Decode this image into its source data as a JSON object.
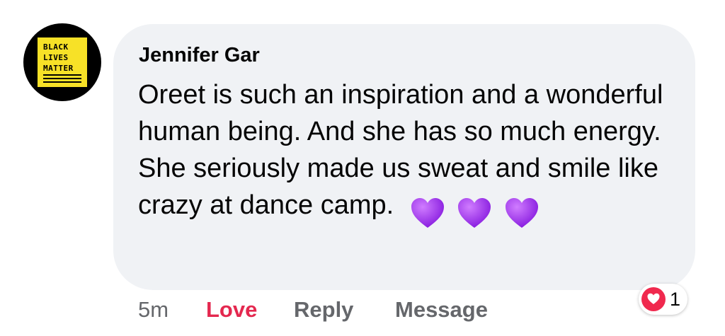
{
  "avatar": {
    "lines": [
      "BLACK",
      "LIVES",
      "MATTER"
    ],
    "colors": {
      "ring": "#000000",
      "tile": "#f7e127",
      "text": "#000000"
    }
  },
  "comment": {
    "author": "Jennifer Gar",
    "text": "Oreet is such an inspiration and a wonderful human being. And she has so much energy. She seriously made us sweat and smile like crazy at dance camp.",
    "emoji": [
      "purple-heart",
      "purple-heart",
      "purple-heart"
    ],
    "bubble_color": "#f0f2f5"
  },
  "actions": {
    "time": "5m",
    "love": "Love",
    "reply": "Reply",
    "message": "Message",
    "love_color": "#e4284f"
  },
  "reaction": {
    "icon": "heart-icon",
    "count": "1",
    "color": "#f0294e"
  }
}
